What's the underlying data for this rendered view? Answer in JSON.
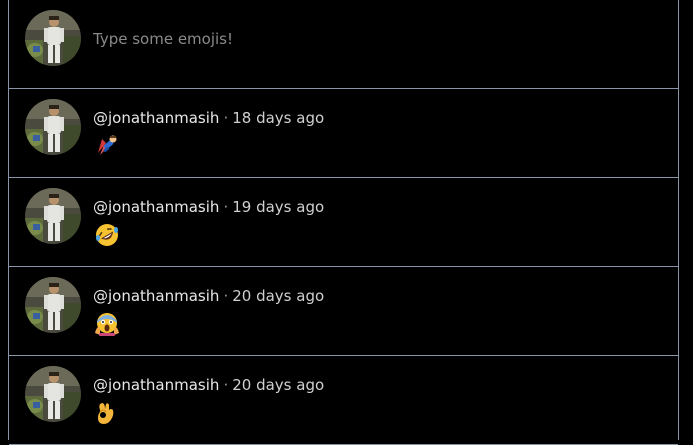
{
  "compose": {
    "placeholder": "Type some emojis!"
  },
  "posts": [
    {
      "username": "@jonathanmasih",
      "time": "18 days ago",
      "emoji": "superhero-emoji"
    },
    {
      "username": "@jonathanmasih",
      "time": "19 days ago",
      "emoji": "rolling-laughing-emoji"
    },
    {
      "username": "@jonathanmasih",
      "time": "20 days ago",
      "emoji": "screaming-face-emoji"
    },
    {
      "username": "@jonathanmasih",
      "time": "20 days ago",
      "emoji": "ok-hand-emoji"
    }
  ],
  "separator": "·",
  "colors": {
    "background": "#000000",
    "border": "#8a93a8",
    "text": "#e8e8e8",
    "placeholder": "#8a8a8a"
  }
}
